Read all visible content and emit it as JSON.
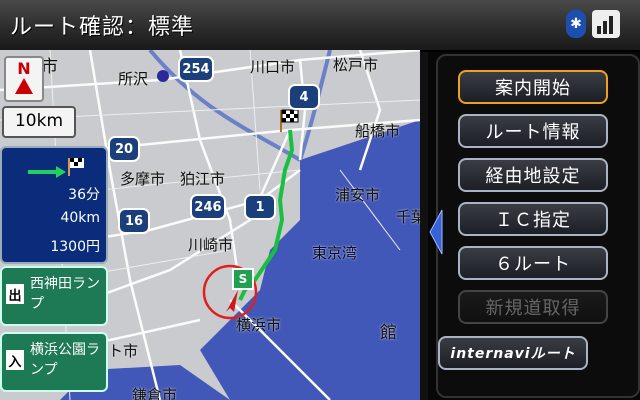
{
  "title": "ルート確認：標準",
  "status": {
    "bluetooth_glyph": "✱"
  },
  "map": {
    "scale_label": "10km",
    "north_label": "N",
    "places": [
      {
        "key": "umeshi",
        "label": "梅市"
      },
      {
        "key": "tokorozawa",
        "label": "所沢"
      },
      {
        "key": "kawaguchi",
        "label": "川口市"
      },
      {
        "key": "matsudo",
        "label": "松戸市"
      },
      {
        "key": "funabashi",
        "label": "船橋市"
      },
      {
        "key": "tama",
        "label": "多摩市"
      },
      {
        "key": "komae",
        "label": "狛江市"
      },
      {
        "key": "urayasu",
        "label": "浦安市"
      },
      {
        "key": "chiba",
        "label": "千葉"
      },
      {
        "key": "kawasaki",
        "label": "川崎市"
      },
      {
        "key": "tokyowan",
        "label": "東京湾"
      },
      {
        "key": "yokohama",
        "label": "横浜市"
      },
      {
        "key": "kan",
        "label": "館"
      },
      {
        "key": "kishi",
        "label": "ト市"
      },
      {
        "key": "kamakura",
        "label": "鎌倉市"
      }
    ],
    "routes": [
      {
        "key": "r254",
        "label": "254"
      },
      {
        "key": "r4",
        "label": "4"
      },
      {
        "key": "r20",
        "label": "20"
      },
      {
        "key": "r246",
        "label": "246"
      },
      {
        "key": "r1",
        "label": "1"
      },
      {
        "key": "r16",
        "label": "16"
      }
    ],
    "start_label": "S"
  },
  "summary": {
    "time": "36分",
    "distance": "40km",
    "fee": "1300円"
  },
  "entry": {
    "in_tag": "出",
    "in_name": "西神田ランプ",
    "out_tag": "入",
    "out_name": "横浜公園ランプ"
  },
  "menu": {
    "items": [
      {
        "key": "start_guide",
        "label": "案内開始",
        "state": "active"
      },
      {
        "key": "route_info",
        "label": "ルート情報",
        "state": "normal"
      },
      {
        "key": "waypoint",
        "label": "経由地設定",
        "state": "normal"
      },
      {
        "key": "ic",
        "label": "ＩＣ指定",
        "state": "normal"
      },
      {
        "key": "six_route",
        "label": "６ルート",
        "state": "normal"
      },
      {
        "key": "new_road",
        "label": "新規道取得",
        "state": "disabled"
      },
      {
        "key": "internavi",
        "label": "internaviルート",
        "state": "normal"
      }
    ]
  },
  "colors": {
    "route_line": "#18c040",
    "sea": "#4258b8",
    "land": "#c9cbce",
    "menu_active_border": "#f0a020"
  }
}
